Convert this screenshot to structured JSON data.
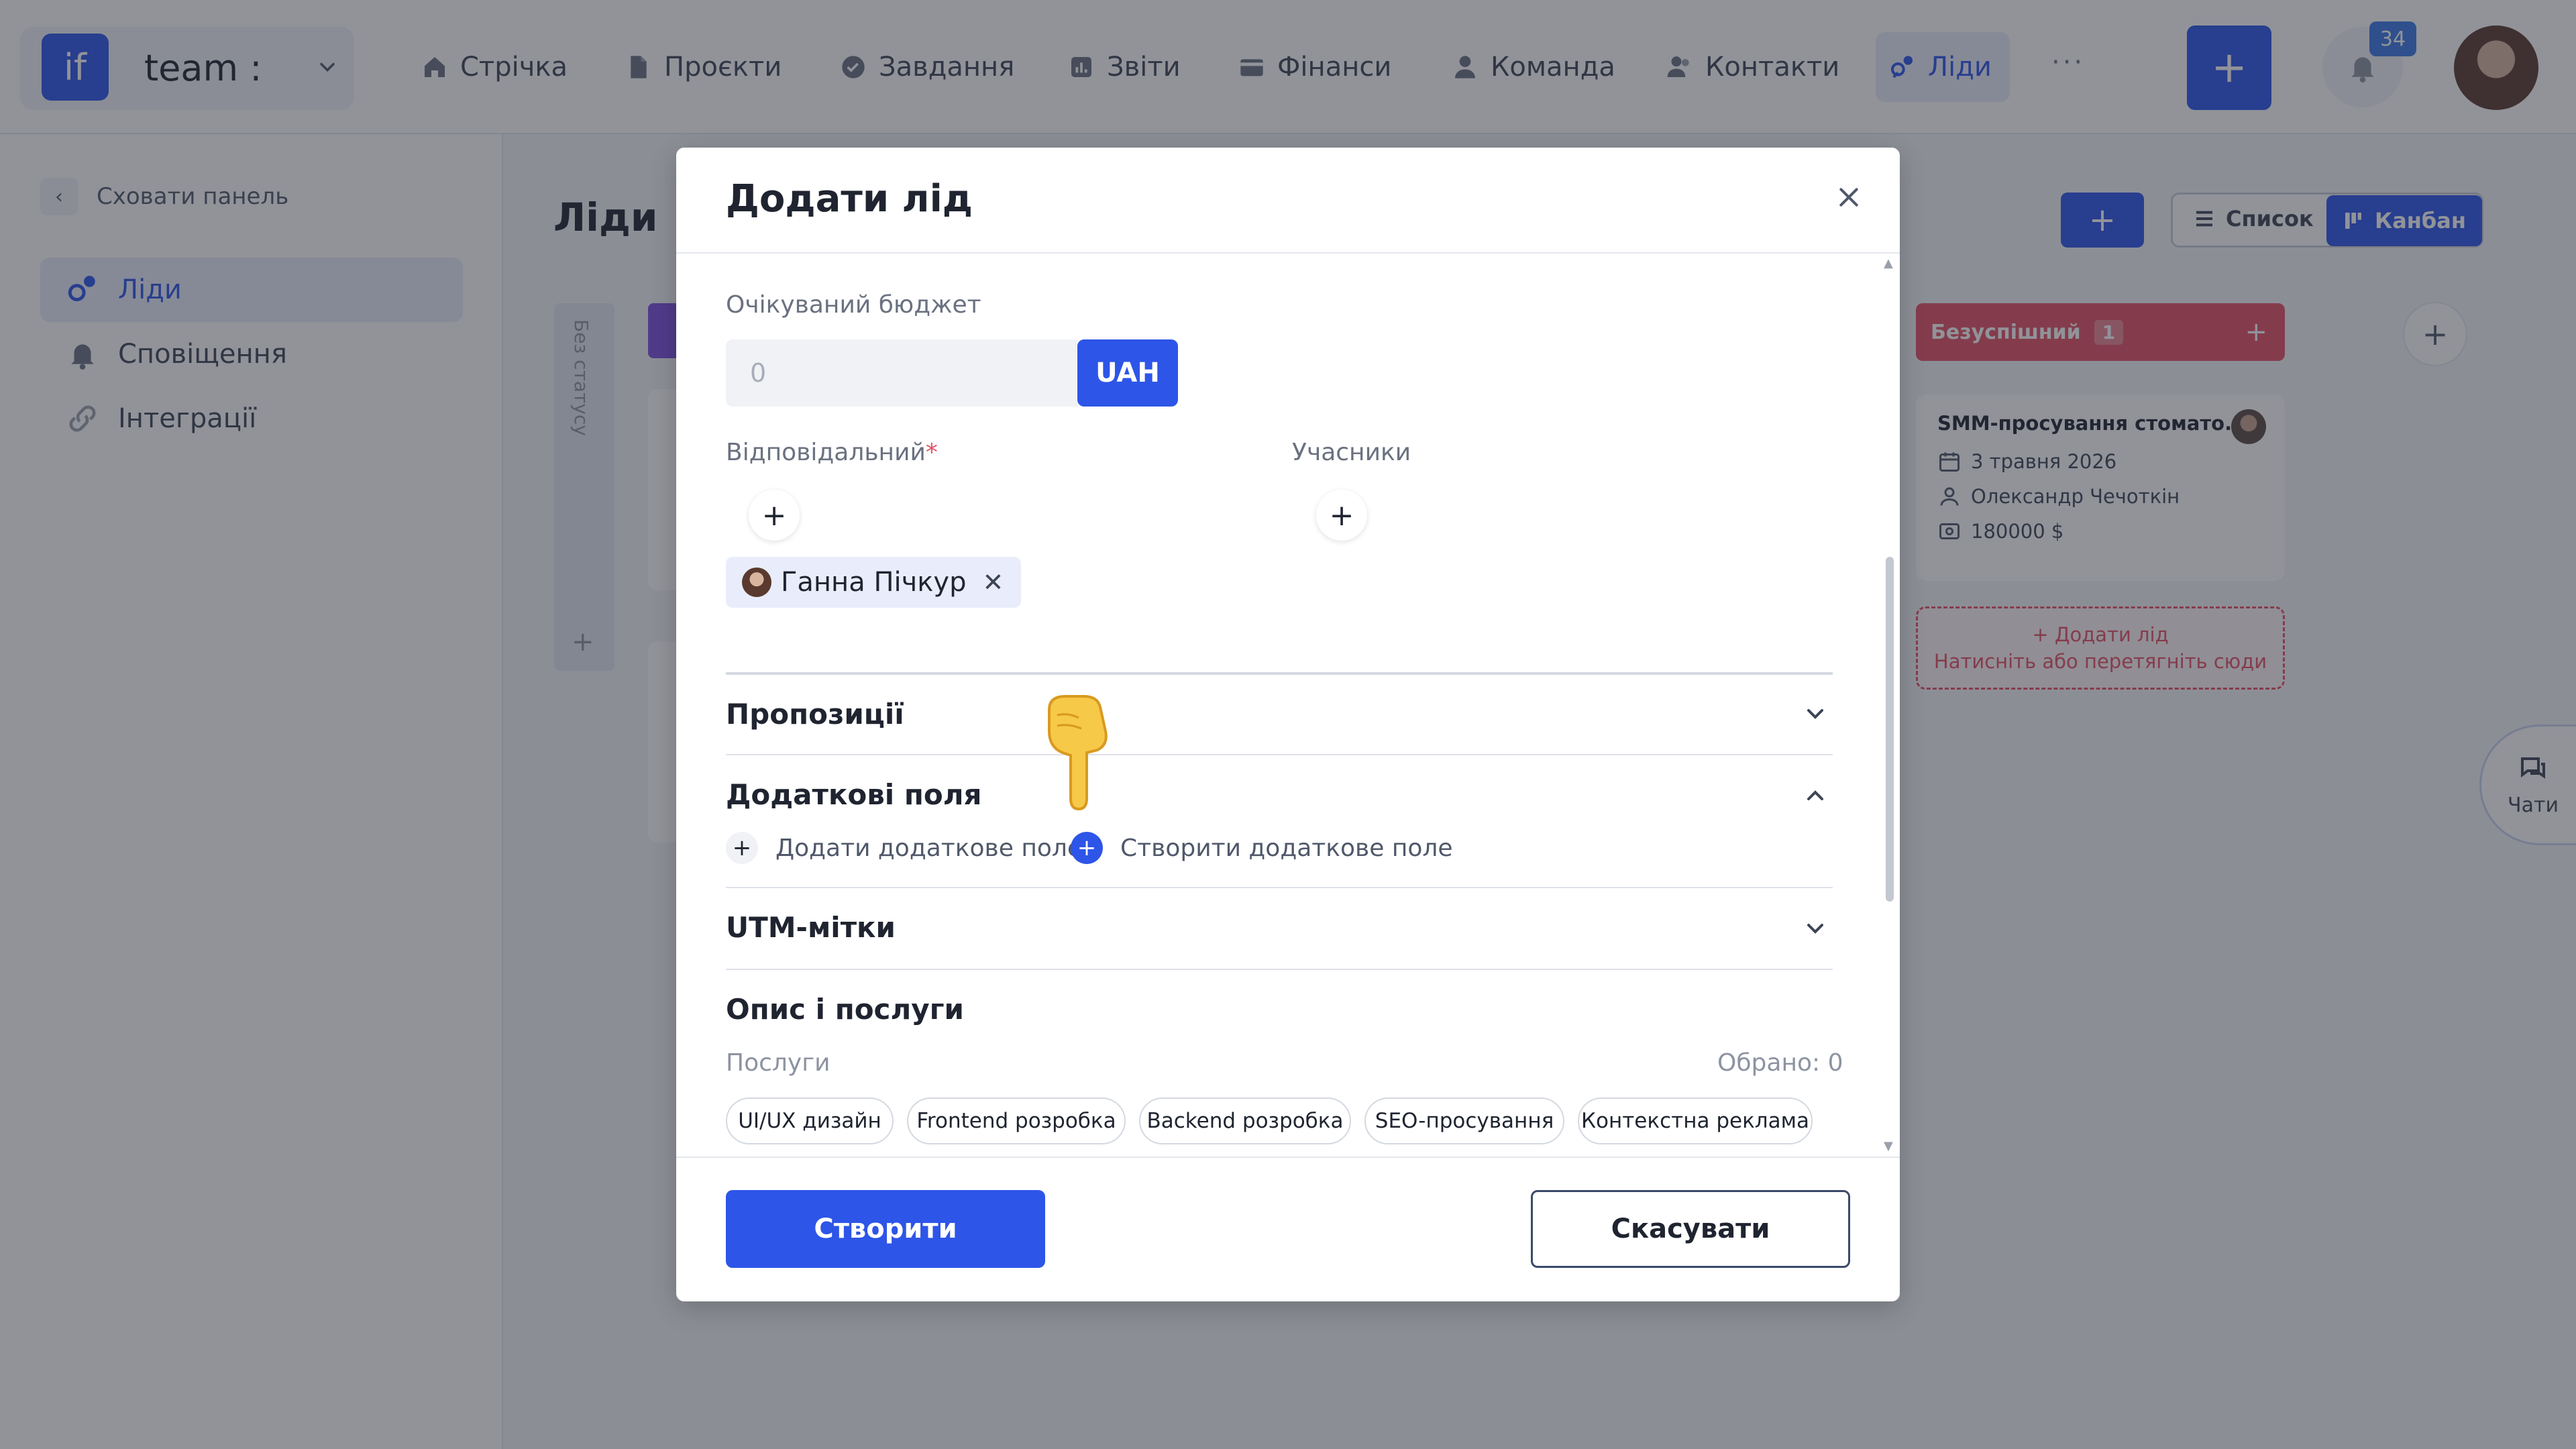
{
  "topbar": {
    "team_logo": "if",
    "team_name": "team :",
    "nav": [
      {
        "label": "Стрічка",
        "icon": "home-icon"
      },
      {
        "label": "Проєкти",
        "icon": "file-icon"
      },
      {
        "label": "Завдання",
        "icon": "check-circle-icon"
      },
      {
        "label": "Звіти",
        "icon": "chart-icon"
      },
      {
        "label": "Фінанси",
        "icon": "wallet-icon"
      },
      {
        "label": "Команда",
        "icon": "user-icon"
      },
      {
        "label": "Контакти",
        "icon": "contacts-icon"
      },
      {
        "label": "Ліди",
        "icon": "leads-icon"
      }
    ],
    "more": "···",
    "add": "+",
    "notifications_count": "34"
  },
  "sidebar": {
    "hide_label": "Сховати панель",
    "items": [
      {
        "label": "Ліди",
        "icon": "leads-icon"
      },
      {
        "label": "Сповіщення",
        "icon": "bell-icon"
      },
      {
        "label": "Інтеграції",
        "icon": "link-icon"
      }
    ]
  },
  "page": {
    "title": "Ліди",
    "add": "+",
    "view_list": "Список",
    "view_kanban": "Канбан",
    "no_status": "Без статусу",
    "column_plus": "+"
  },
  "kanban": {
    "failed_column": {
      "title": "Безуспішний",
      "count": "1",
      "plus": "+"
    },
    "card": {
      "title": "SMM-просування стомато...",
      "date": "3 травня 2026",
      "owner": "Олександр Чечоткін",
      "amount": "180000 $"
    },
    "drop_zone_line1": "+ Додати лід",
    "drop_zone_line2": "Натисніть або перетягніть сюди",
    "add_column": "+",
    "chats": "Чати"
  },
  "modal": {
    "title": "Додати лід",
    "budget_label": "Очікуваний бюджет",
    "budget_placeholder": "0",
    "currency": "UAH",
    "responsible_label": "Відповідальний",
    "required_mark": "*",
    "participants_label": "Учасники",
    "plus": "+",
    "responsible_chip": "Ганна Пічкур",
    "chip_remove": "✕",
    "sections": {
      "proposals": "Пропозиції",
      "extra_fields": "Додаткові поля",
      "utm": "UTM-мітки",
      "description": "Опис і послуги"
    },
    "add_extra_field": "Додати додаткове поле",
    "create_extra_field": "Створити додаткове поле",
    "services_label": "Послуги",
    "selected_count": "Обрано: 0",
    "services": [
      "UI/UX дизайн",
      "Frontend розробка",
      "Backend розробка",
      "SEO-просування",
      "Контекстна реклама"
    ],
    "create_button": "Створити",
    "cancel_button": "Скасувати"
  }
}
